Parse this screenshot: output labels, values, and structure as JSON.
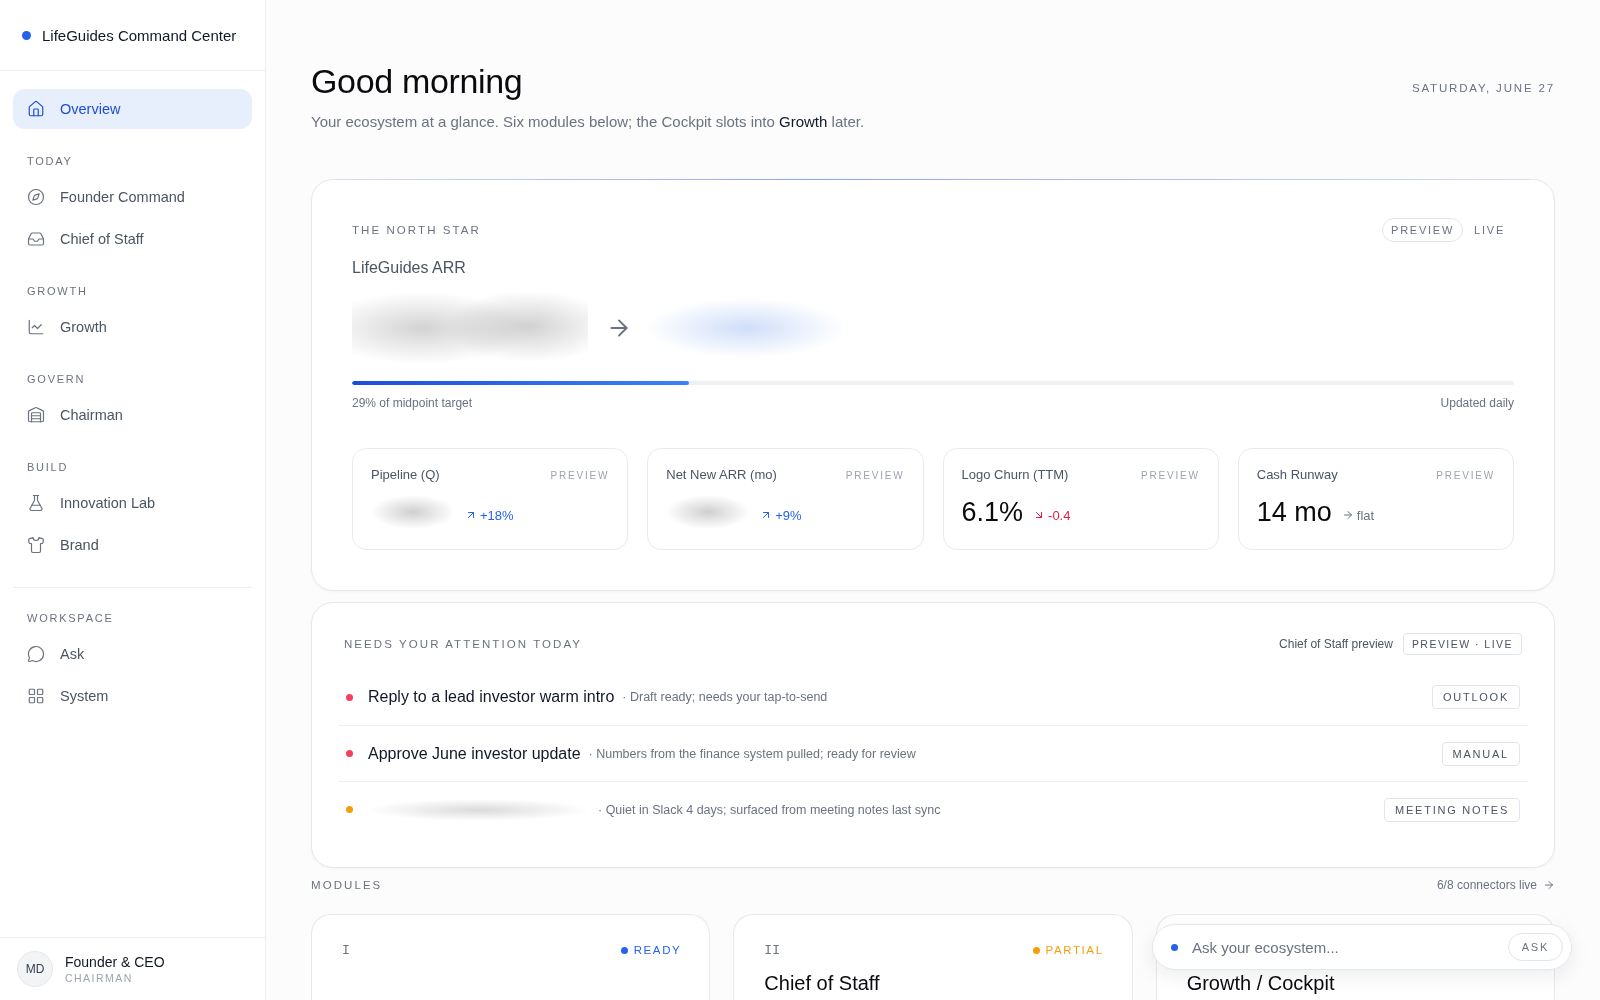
{
  "sidebar": {
    "brand": "LifeGuides Command Center",
    "groups": [
      {
        "items": [
          {
            "label": "Overview",
            "selected": true
          }
        ]
      },
      {
        "title": "TODAY",
        "items": [
          {
            "label": "Founder Command",
            "selected": false
          },
          {
            "label": "Chief of Staff",
            "selected": false
          }
        ]
      },
      {
        "title": "GROWTH",
        "items": [
          {
            "label": "Growth",
            "selected": false
          }
        ]
      },
      {
        "title": "GOVERN",
        "items": [
          {
            "label": "Chairman",
            "selected": false
          }
        ]
      },
      {
        "title": "BUILD",
        "items": [
          {
            "label": "Innovation Lab",
            "selected": false
          },
          {
            "label": "Brand",
            "selected": false
          }
        ]
      },
      {
        "title": "WORKSPACE",
        "items": [
          {
            "label": "Ask",
            "selected": false
          },
          {
            "label": "System",
            "selected": false
          }
        ]
      }
    ],
    "user": {
      "initials": "MD",
      "name": "Founder & CEO",
      "role": "CHAIRMAN"
    }
  },
  "header": {
    "title": "Good morning",
    "subtitle": "Your ecosystem at a glance. Six modules below; the Cockpit slots into **Growth** later.",
    "date": "SATURDAY, JUNE 27"
  },
  "north_star": {
    "eyebrow": "THE NORTH STAR",
    "modes": [
      {
        "label": "PREVIEW",
        "selected": true
      },
      {
        "label": "LIVE",
        "selected": false
      }
    ],
    "metric": "LifeGuides ARR",
    "progress": {
      "level": 0.29,
      "caption": "29% of midpoint target",
      "note": "Updated daily"
    },
    "kpis": [
      {
        "label": "Pipeline (Q)",
        "badge": "PREVIEW",
        "redacted": true,
        "change": {
          "text": "+18%",
          "kind": "up"
        }
      },
      {
        "label": "Net New ARR (mo)",
        "badge": "PREVIEW",
        "redacted": true,
        "change": {
          "text": "+9%",
          "kind": "up"
        }
      },
      {
        "label": "Logo Churn (TTM)",
        "badge": "PREVIEW",
        "redacted": false,
        "value": "6.1%",
        "change": {
          "text": "-0.4",
          "kind": "down"
        }
      },
      {
        "label": "Cash Runway",
        "badge": "PREVIEW",
        "redacted": false,
        "value": "14 mo",
        "change": {
          "text": "flat",
          "kind": "flat"
        }
      }
    ]
  },
  "attention": {
    "title": "NEEDS YOUR ATTENTION TODAY",
    "source": "Chief of Staff preview",
    "mode": "PREVIEW · LIVE",
    "items": [
      {
        "title": "Reply to a lead investor warm intro",
        "redacted": false,
        "detail": "· Draft ready; needs your tap-to-send",
        "tag": "OUTLOOK",
        "color": "#f43f5e"
      },
      {
        "title": "Approve June investor update",
        "redacted": false,
        "detail": "· Numbers from the finance system pulled; ready for review",
        "tag": "MANUAL",
        "color": "#f43f5e"
      },
      {
        "redacted": true,
        "detail": "· Quiet in Slack 4 days; surfaced from meeting notes last sync",
        "tag": "MEETING NOTES",
        "color": "#f59e0b"
      }
    ]
  },
  "modules": {
    "title": "MODULES",
    "link": "6/8 connectors live",
    "items": [
      {
        "numeral": "I",
        "status": "READY",
        "color": "#2563eb"
      },
      {
        "numeral": "II",
        "status": "PARTIAL",
        "color": "#f59e0b",
        "title": "Chief of Staff"
      },
      {
        "title": "Growth / Cockpit"
      }
    ]
  },
  "ask_bar": {
    "placeholder": "Ask your ecosystem...",
    "button": "ASK"
  }
}
